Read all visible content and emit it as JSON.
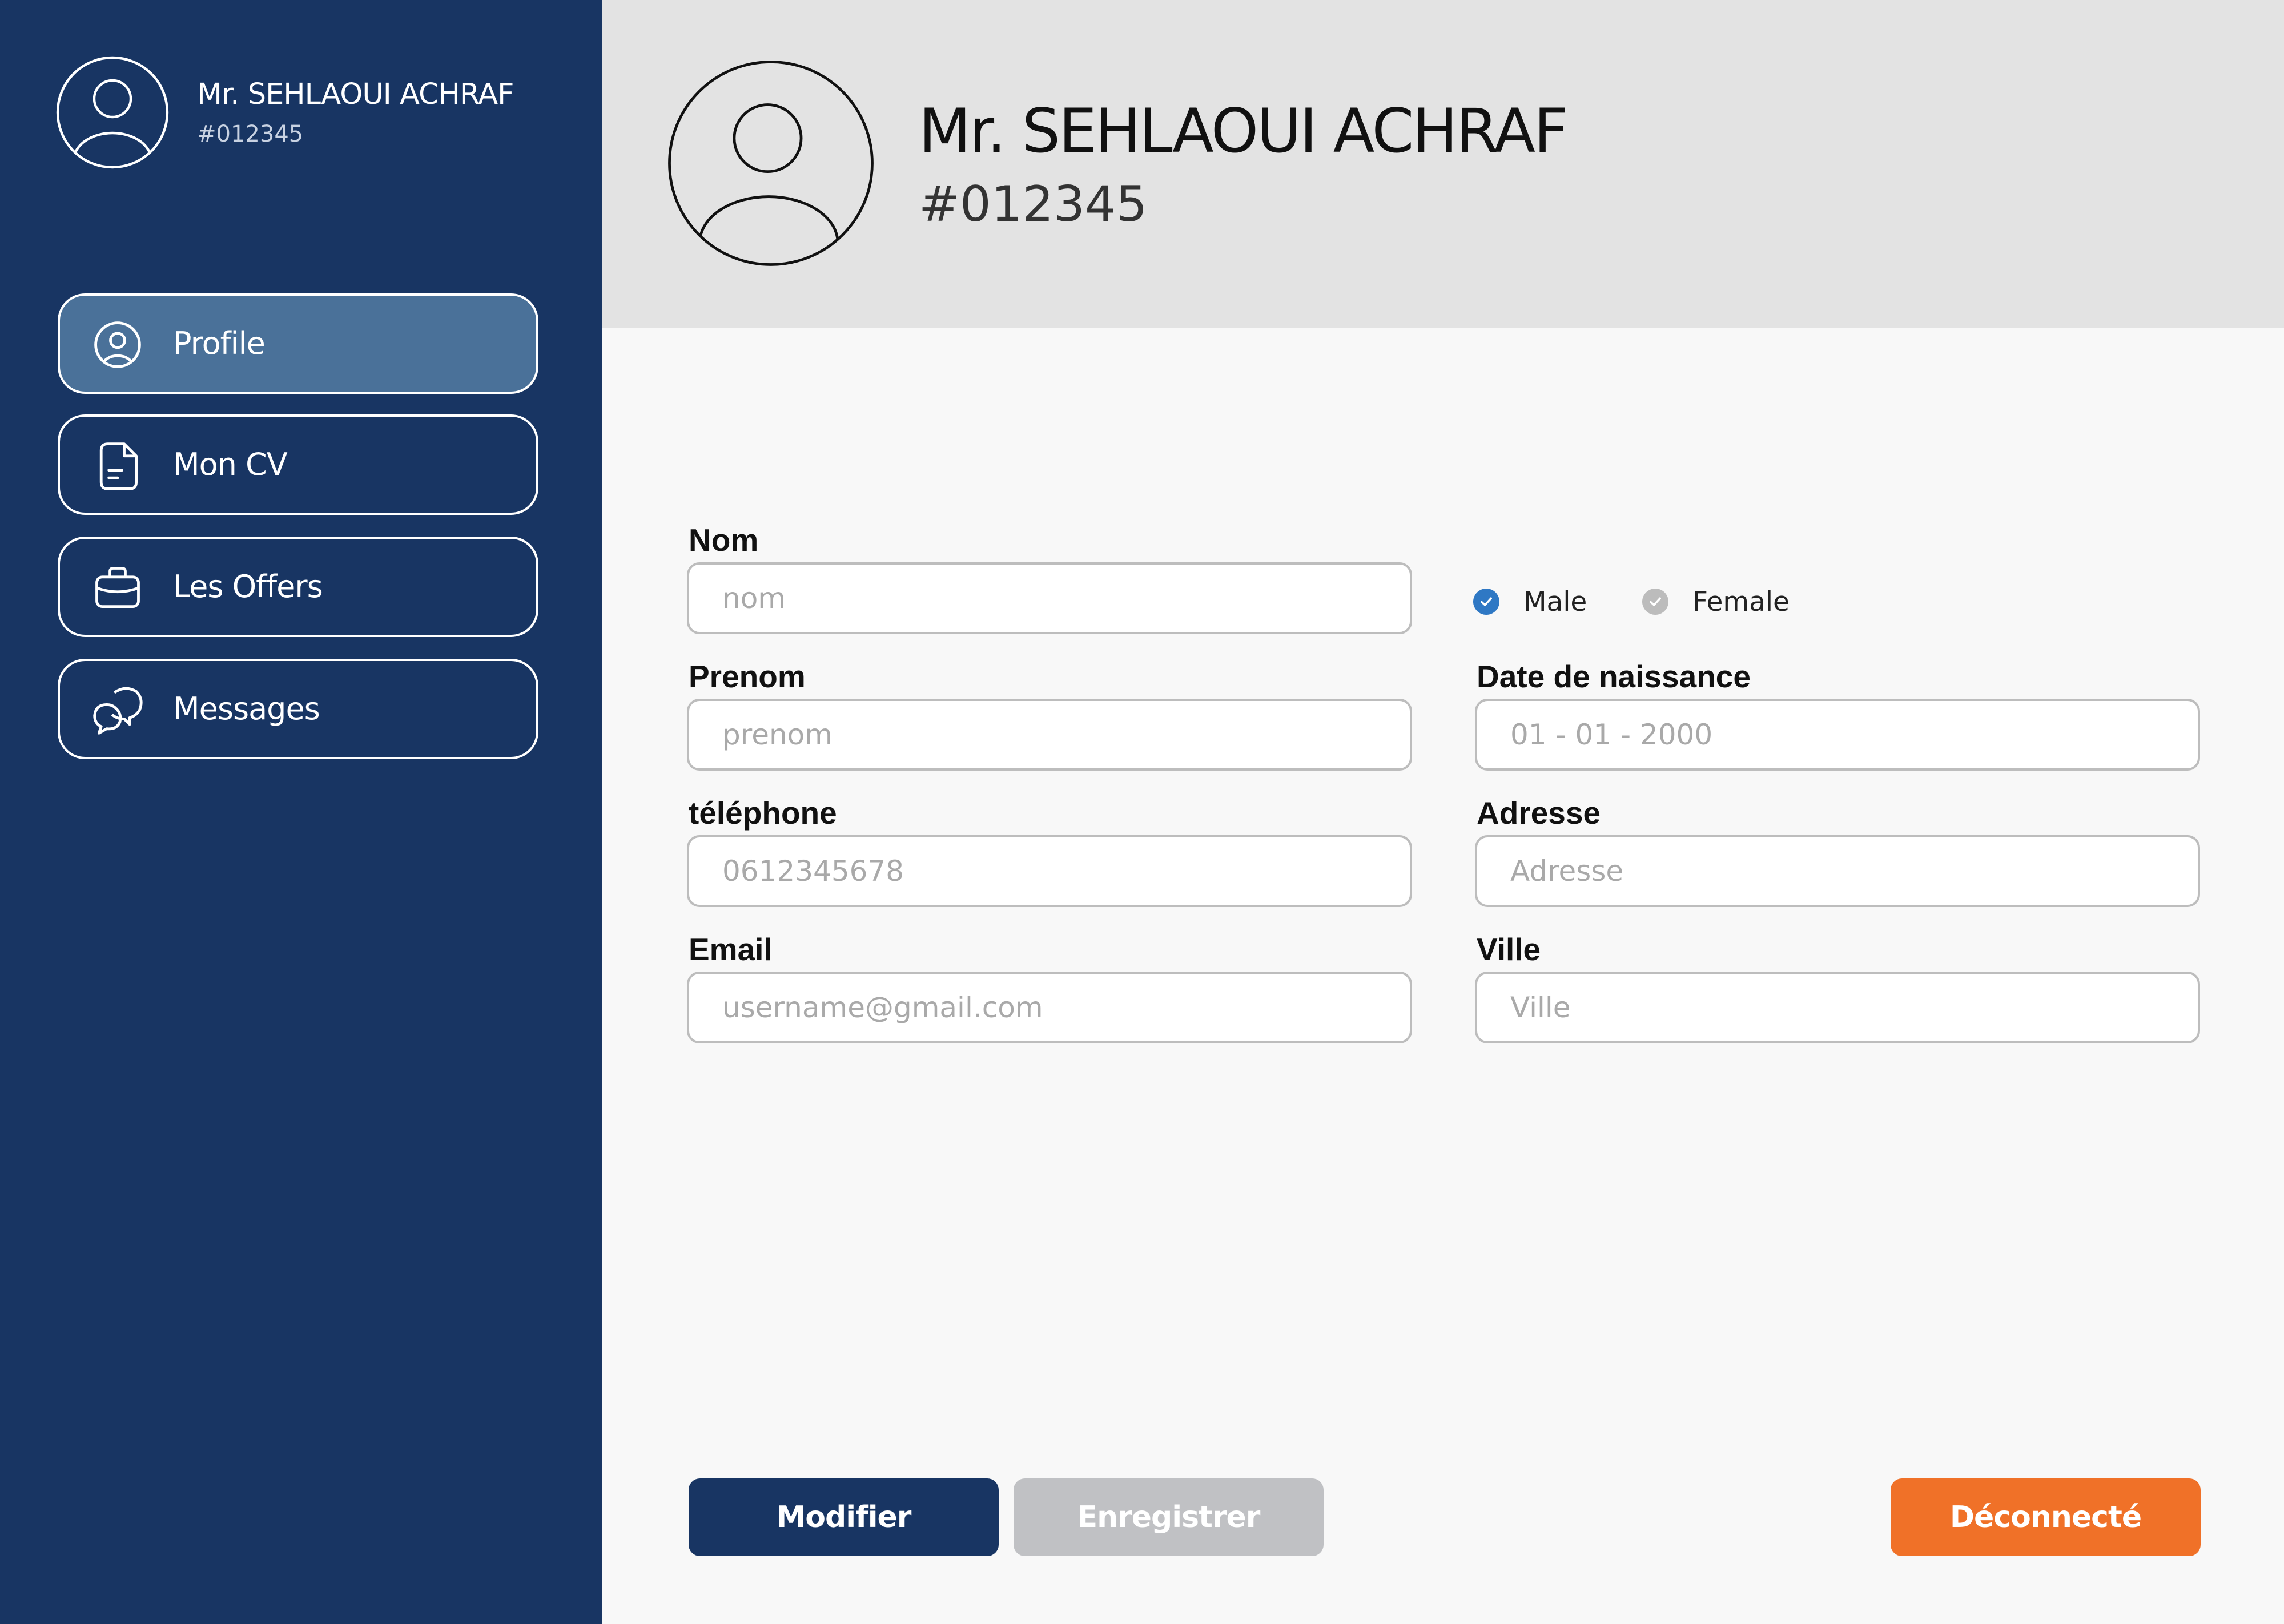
{
  "user": {
    "name": "Mr. SEHLAOUI ACHRAF",
    "id": "#012345"
  },
  "sidebar": {
    "items": [
      {
        "label": "Profile",
        "icon": "user-circle-icon",
        "active": true
      },
      {
        "label": "Mon CV",
        "icon": "document-icon",
        "active": false
      },
      {
        "label": "Les Offers",
        "icon": "briefcase-icon",
        "active": false
      },
      {
        "label": "Messages",
        "icon": "chat-bubbles-icon",
        "active": false
      }
    ]
  },
  "form": {
    "nom": {
      "label": "Nom",
      "placeholder": "nom"
    },
    "prenom": {
      "label": "Prenom",
      "placeholder": "prenom"
    },
    "telephone": {
      "label": "téléphone",
      "placeholder": "0612345678"
    },
    "email": {
      "label": "Email",
      "placeholder": "username@gmail.com"
    },
    "gender": {
      "male": {
        "label": "Male",
        "checked": true
      },
      "female": {
        "label": "Female",
        "checked": false
      }
    },
    "date_naissance": {
      "label": "Date de naissance",
      "placeholder": "01 - 01 - 2000"
    },
    "adresse": {
      "label": "Adresse",
      "placeholder": "Adresse"
    },
    "ville": {
      "label": "Ville",
      "placeholder": "Ville"
    }
  },
  "actions": {
    "modifier": "Modifier",
    "enregistrer": "Enregistrer",
    "deconnecte": "Déconnecté"
  },
  "colors": {
    "sidebar": "#183563",
    "sidebar_active": "#4a7199",
    "header": "#e3e3e3",
    "content": "#f8f8f8",
    "primary_button": "#183563",
    "disabled_button": "#c0c1c4",
    "logout_button": "#f07128",
    "radio_checked": "#2f78c4",
    "radio_unchecked": "#bcbcbc"
  }
}
